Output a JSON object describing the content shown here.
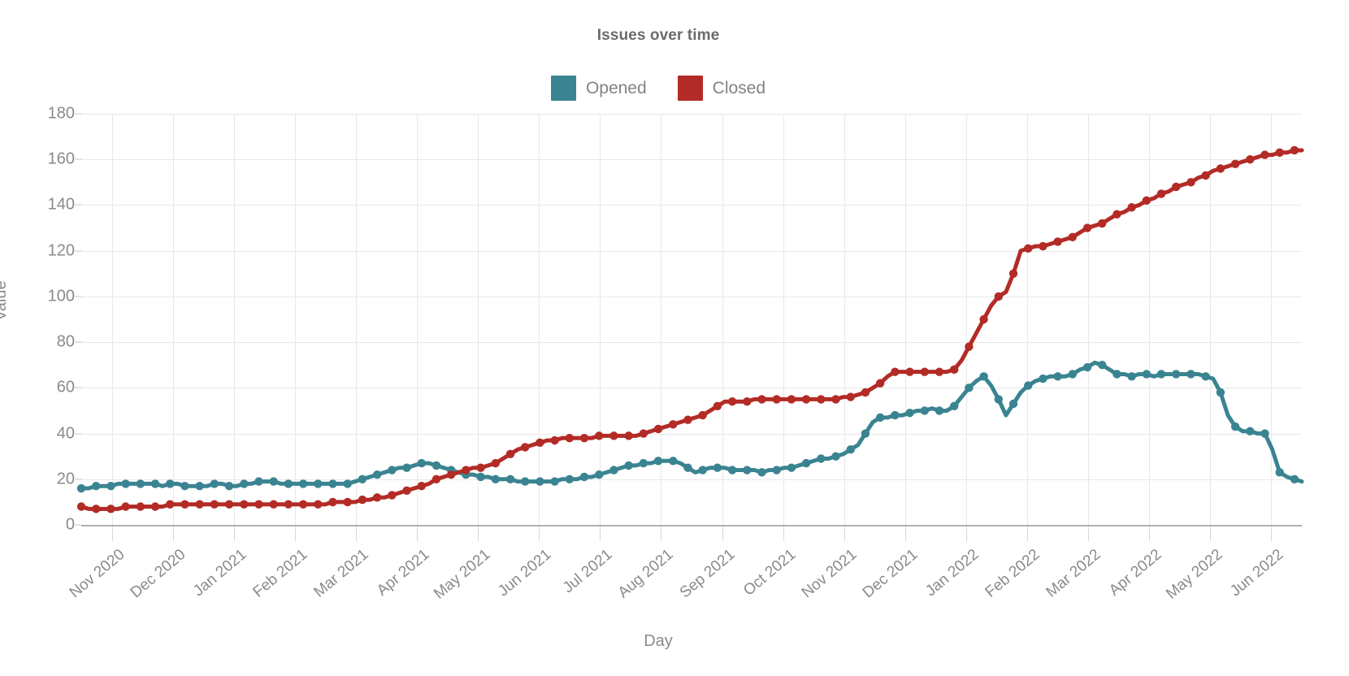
{
  "chart_data": {
    "type": "line",
    "title": "Issues over time",
    "xlabel": "Day",
    "ylabel": "Value",
    "ylim": [
      0,
      180
    ],
    "yticks": [
      0,
      20,
      40,
      60,
      80,
      100,
      120,
      140,
      160,
      180
    ],
    "grid": true,
    "legend_position": "top-center",
    "xtick_labels": [
      "Nov 2020",
      "Dec 2020",
      "Jan 2021",
      "Feb 2021",
      "Mar 2021",
      "Apr 2021",
      "May 2021",
      "Jun 2021",
      "Jul 2021",
      "Aug 2021",
      "Sep 2021",
      "Oct 2021",
      "Nov 2021",
      "Dec 2021",
      "Jan 2022",
      "Feb 2022",
      "Mar 2022",
      "Apr 2022",
      "May 2022",
      "Jun 2022"
    ],
    "series": [
      {
        "name": "Opened",
        "color": "#3a8491",
        "values": [
          16,
          16,
          17,
          17,
          17,
          18,
          18,
          18,
          18,
          18,
          18,
          17,
          18,
          18,
          17,
          17,
          17,
          17,
          18,
          18,
          17,
          17,
          18,
          18,
          19,
          19,
          19,
          18,
          18,
          18,
          18,
          18,
          18,
          18,
          18,
          18,
          18,
          19,
          20,
          21,
          22,
          23,
          24,
          25,
          25,
          26,
          27,
          27,
          26,
          25,
          24,
          23,
          22,
          22,
          21,
          21,
          20,
          20,
          20,
          19,
          19,
          19,
          19,
          19,
          19,
          20,
          20,
          20,
          21,
          21,
          22,
          23,
          24,
          25,
          26,
          26,
          27,
          27,
          28,
          28,
          28,
          27,
          25,
          23,
          24,
          25,
          25,
          25,
          24,
          24,
          24,
          24,
          23,
          24,
          24,
          25,
          25,
          26,
          27,
          28,
          29,
          29,
          30,
          31,
          33,
          35,
          40,
          45,
          47,
          47,
          48,
          48,
          49,
          50,
          50,
          51,
          50,
          50,
          52,
          56,
          60,
          63,
          65,
          61,
          55,
          48,
          53,
          58,
          61,
          63,
          64,
          65,
          65,
          65,
          66,
          68,
          69,
          71,
          70,
          68,
          66,
          66,
          65,
          66,
          66,
          65,
          66,
          66,
          66,
          66,
          66,
          66,
          65,
          64,
          58,
          48,
          43,
          41,
          41,
          40,
          40,
          33,
          23,
          21,
          20,
          19
        ]
      },
      {
        "name": "Closed",
        "color": "#b32b26",
        "values": [
          8,
          7,
          7,
          7,
          7,
          7,
          8,
          8,
          8,
          8,
          8,
          8,
          9,
          9,
          9,
          9,
          9,
          9,
          9,
          9,
          9,
          9,
          9,
          9,
          9,
          9,
          9,
          9,
          9,
          9,
          9,
          9,
          9,
          9,
          10,
          10,
          10,
          10,
          11,
          11,
          12,
          12,
          13,
          14,
          15,
          16,
          17,
          18,
          20,
          21,
          22,
          23,
          24,
          25,
          25,
          26,
          27,
          29,
          31,
          33,
          34,
          35,
          36,
          37,
          37,
          38,
          38,
          38,
          38,
          38,
          39,
          39,
          39,
          39,
          39,
          39,
          40,
          41,
          42,
          43,
          44,
          45,
          46,
          47,
          48,
          50,
          52,
          54,
          54,
          54,
          54,
          55,
          55,
          55,
          55,
          55,
          55,
          55,
          55,
          55,
          55,
          55,
          55,
          56,
          56,
          57,
          58,
          60,
          62,
          65,
          67,
          67,
          67,
          67,
          67,
          67,
          67,
          67,
          68,
          72,
          78,
          84,
          90,
          96,
          100,
          102,
          110,
          120,
          121,
          122,
          122,
          123,
          124,
          125,
          126,
          128,
          130,
          131,
          132,
          134,
          136,
          137,
          139,
          140,
          142,
          143,
          145,
          146,
          148,
          149,
          150,
          152,
          153,
          155,
          156,
          157,
          158,
          159,
          160,
          161,
          162,
          162,
          163,
          163,
          164,
          164
        ]
      }
    ]
  },
  "chart": {
    "title": "Issues over time",
    "x_axis_title": "Day",
    "y_axis_title": "Value"
  },
  "legend": {
    "items": [
      {
        "label": "Opened",
        "color": "#3a8491"
      },
      {
        "label": "Closed",
        "color": "#b32b26"
      }
    ]
  }
}
